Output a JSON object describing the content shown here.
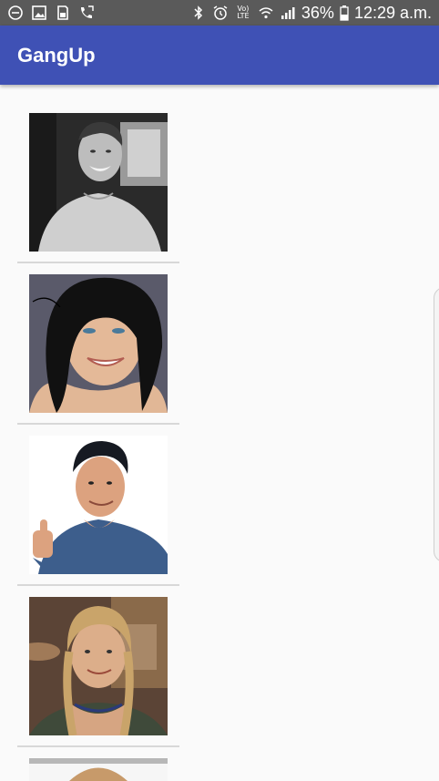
{
  "status_bar": {
    "battery_percent": "36%",
    "time": "12:29 a.m.",
    "volte_top": "Vo)",
    "volte_bottom": "LTE",
    "left_icons": [
      "minus-circle-icon",
      "image-icon",
      "save-icon",
      "call-forward-icon"
    ],
    "right_icons": [
      "bluetooth-icon",
      "alarm-icon",
      "volte-icon",
      "wifi-icon",
      "signal-icon",
      "battery-icon"
    ]
  },
  "app_bar": {
    "title": "GangUp",
    "color": "#3f51b5"
  },
  "list": {
    "items": [
      {
        "photo": "portrait-photo",
        "style": "black-and-white"
      },
      {
        "photo": "portrait-photo",
        "style": "color"
      },
      {
        "photo": "portrait-photo",
        "style": "color"
      },
      {
        "photo": "portrait-photo",
        "style": "color"
      },
      {
        "photo": "portrait-photo",
        "style": "partially-visible"
      }
    ]
  }
}
